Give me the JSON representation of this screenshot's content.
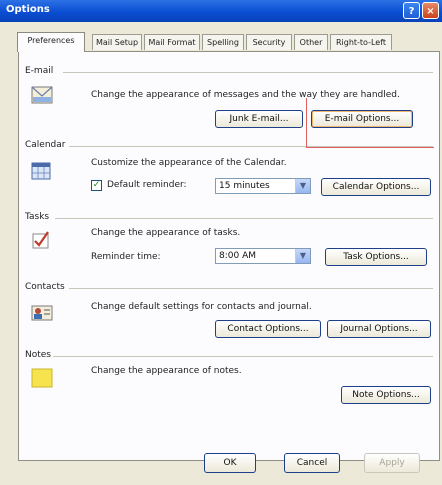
{
  "window": {
    "title": "Options"
  },
  "titlebar": {
    "help_glyph": "?",
    "close_glyph": "×"
  },
  "tabs": [
    {
      "label": "Preferences",
      "active": true
    },
    {
      "label": "Mail Setup"
    },
    {
      "label": "Mail Format"
    },
    {
      "label": "Spelling"
    },
    {
      "label": "Security"
    },
    {
      "label": "Other"
    },
    {
      "label": "Right-to-Left"
    }
  ],
  "email": {
    "title": "E-mail",
    "description": "Change the appearance of messages and the way they are handled.",
    "junk_button": "Junk E-mail...",
    "options_button": "E-mail Options..."
  },
  "calendar": {
    "title": "Calendar",
    "description": "Customize the appearance of the Calendar.",
    "reminder_label": "Default reminder:",
    "reminder_checked": true,
    "reminder_value": "15 minutes",
    "options_button": "Calendar Options..."
  },
  "tasks": {
    "title": "Tasks",
    "description": "Change the appearance of tasks.",
    "reminder_label": "Reminder time:",
    "reminder_value": "8:00 AM",
    "options_button": "Task Options..."
  },
  "contacts": {
    "title": "Contacts",
    "description": "Change default settings for contacts and journal.",
    "contact_button": "Contact Options...",
    "journal_button": "Journal Options..."
  },
  "notes": {
    "title": "Notes",
    "description": "Change the appearance of notes.",
    "options_button": "Note Options..."
  },
  "footer": {
    "ok": "OK",
    "cancel": "Cancel",
    "apply": "Apply"
  },
  "icons": {
    "email": "envelope-icon",
    "calendar": "calendar-icon",
    "tasks": "task-check-icon",
    "contacts": "contact-card-icon",
    "notes": "note-icon"
  },
  "colors": {
    "titlebar": "#0a4ed3",
    "highlight_box": "#e06060",
    "dialog_bg": "#ece9d8"
  }
}
